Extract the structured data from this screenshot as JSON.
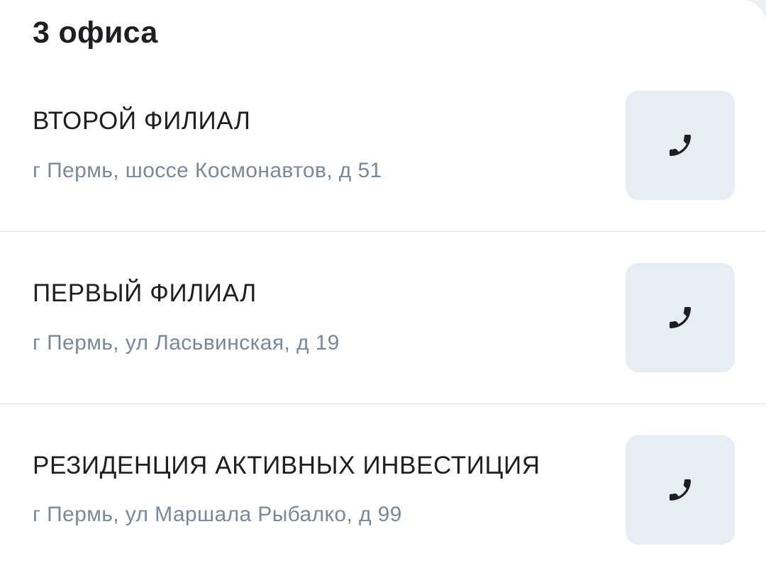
{
  "header": {
    "title": "3 офиса"
  },
  "offices": [
    {
      "name": "ВТОРОЙ ФИЛИАЛ",
      "address": "г Пермь, шоссе Космонавтов, д 51",
      "call_icon": "phone-icon"
    },
    {
      "name": "ПЕРВЫЙ ФИЛИАЛ",
      "address": "г Пермь, ул Ласьвинская, д 19",
      "call_icon": "phone-icon"
    },
    {
      "name": "РЕЗИДЕНЦИЯ АКТИВНЫХ ИНВЕСТИЦИЯ",
      "address": "г Пермь, ул Маршала Рыбалко, д 99",
      "call_icon": "phone-icon"
    }
  ],
  "colors": {
    "card_background": "#ffffff",
    "page_background": "#edeff2",
    "title_text": "#1d1f23",
    "address_text": "#7a8898",
    "call_button_bg": "#e8edf3",
    "divider": "#e2e5e9"
  }
}
